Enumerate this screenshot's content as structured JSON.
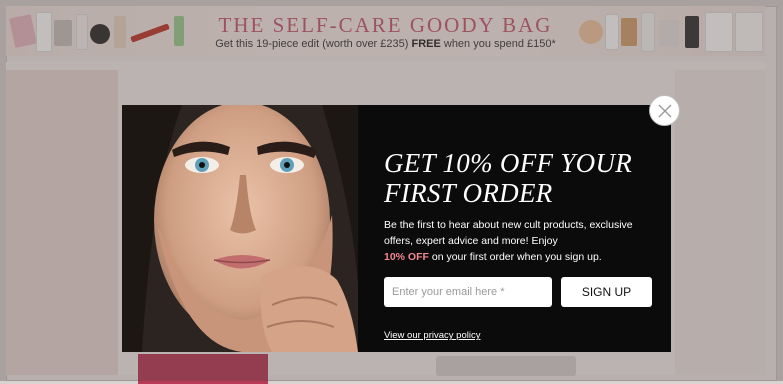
{
  "banner": {
    "title": "THE SELF-CARE GOODY BAG",
    "subtitle_prefix": "Get this 19-piece edit (worth over £235) ",
    "subtitle_bold": "FREE",
    "subtitle_suffix": " when you spend £150*",
    "title_color": "#c65b6e"
  },
  "modal": {
    "heading_line1": "GET 10% OFF YOUR",
    "heading_line2": "FIRST ORDER",
    "body_text": "Be the first to hear about new cult products, exclusive offers, expert advice and more! Enjoy",
    "body_highlight": "10% OFF",
    "body_suffix": " on your first order when you sign up.",
    "highlight_color": "#f2878f",
    "email_placeholder": "Enter your email here *",
    "email_value": "",
    "signup_label": "SIGN UP",
    "privacy_label": "View our privacy policy",
    "close_icon": "close-icon",
    "background_color": "#0b0b0b"
  }
}
